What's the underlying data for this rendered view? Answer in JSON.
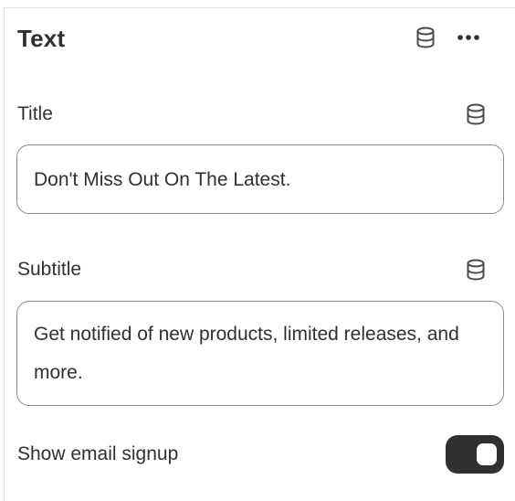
{
  "panel": {
    "title": "Text",
    "header_icons": [
      "database-icon",
      "more-horizontal-icon"
    ]
  },
  "fields": {
    "title": {
      "label": "Title",
      "value": "Don't Miss Out On The Latest.",
      "icon": "database-icon"
    },
    "subtitle": {
      "label": "Subtitle",
      "value": "Get notified of new products, limited releases, and more.",
      "icon": "database-icon"
    },
    "email_signup": {
      "label": "Show email signup",
      "enabled": true
    }
  },
  "colors": {
    "text": "#303030",
    "border": "#8a8a8a",
    "toggle_on": "#303030"
  }
}
